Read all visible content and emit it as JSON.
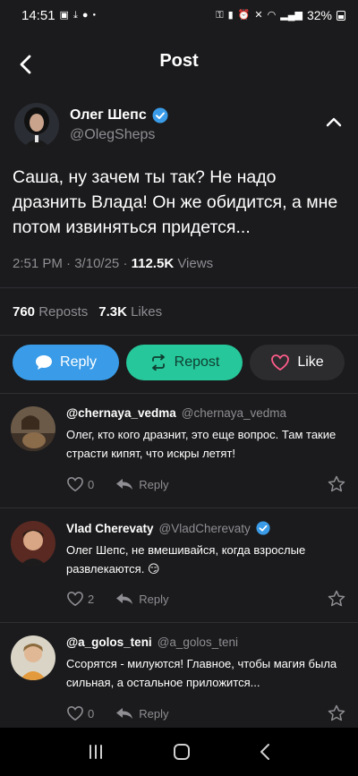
{
  "status": {
    "time": "14:51",
    "battery": "32%"
  },
  "header": {
    "title": "Post"
  },
  "post": {
    "author_name": "Олег Шепс",
    "author_handle": "@OlegSheps",
    "text": "Саша, ну зачем ты так? Не надо дразнить Влада! Он же обидится, а мне потом извиняться придется...",
    "time": "2:51 PM",
    "date": "3/10/25",
    "views": "112.5K",
    "views_label": "Views",
    "reposts": "760",
    "reposts_label": "Reposts",
    "likes": "7.3K",
    "likes_label": "Likes"
  },
  "actions": {
    "reply": "Reply",
    "repost": "Repost",
    "like": "Like"
  },
  "comments": [
    {
      "name": "@chernaya_vedma",
      "handle": "@chernaya_vedma",
      "verified": false,
      "text": "Олег, кто кого дразнит, это еще вопрос. Там такие страсти кипят, что искры летят!",
      "likes": "0",
      "reply_label": "Reply"
    },
    {
      "name": "Vlad Cherevaty",
      "handle": "@VladCherevaty",
      "verified": true,
      "text": "Олег Шепс, не вмешивайся, когда взрослые развлекаются. 😏",
      "likes": "2",
      "reply_label": "Reply"
    },
    {
      "name": "@a_golos_teni",
      "handle": "@a_golos_teni",
      "verified": false,
      "text": "Ссорятся - милуются! Главное, чтобы магия была сильная, а остальное приложится...",
      "likes": "0",
      "reply_label": "Reply"
    }
  ],
  "colors": {
    "reply": "#3a9ce8",
    "repost": "#26c79a",
    "verified": "#3a9ce8",
    "background": "#1b1b1d"
  }
}
